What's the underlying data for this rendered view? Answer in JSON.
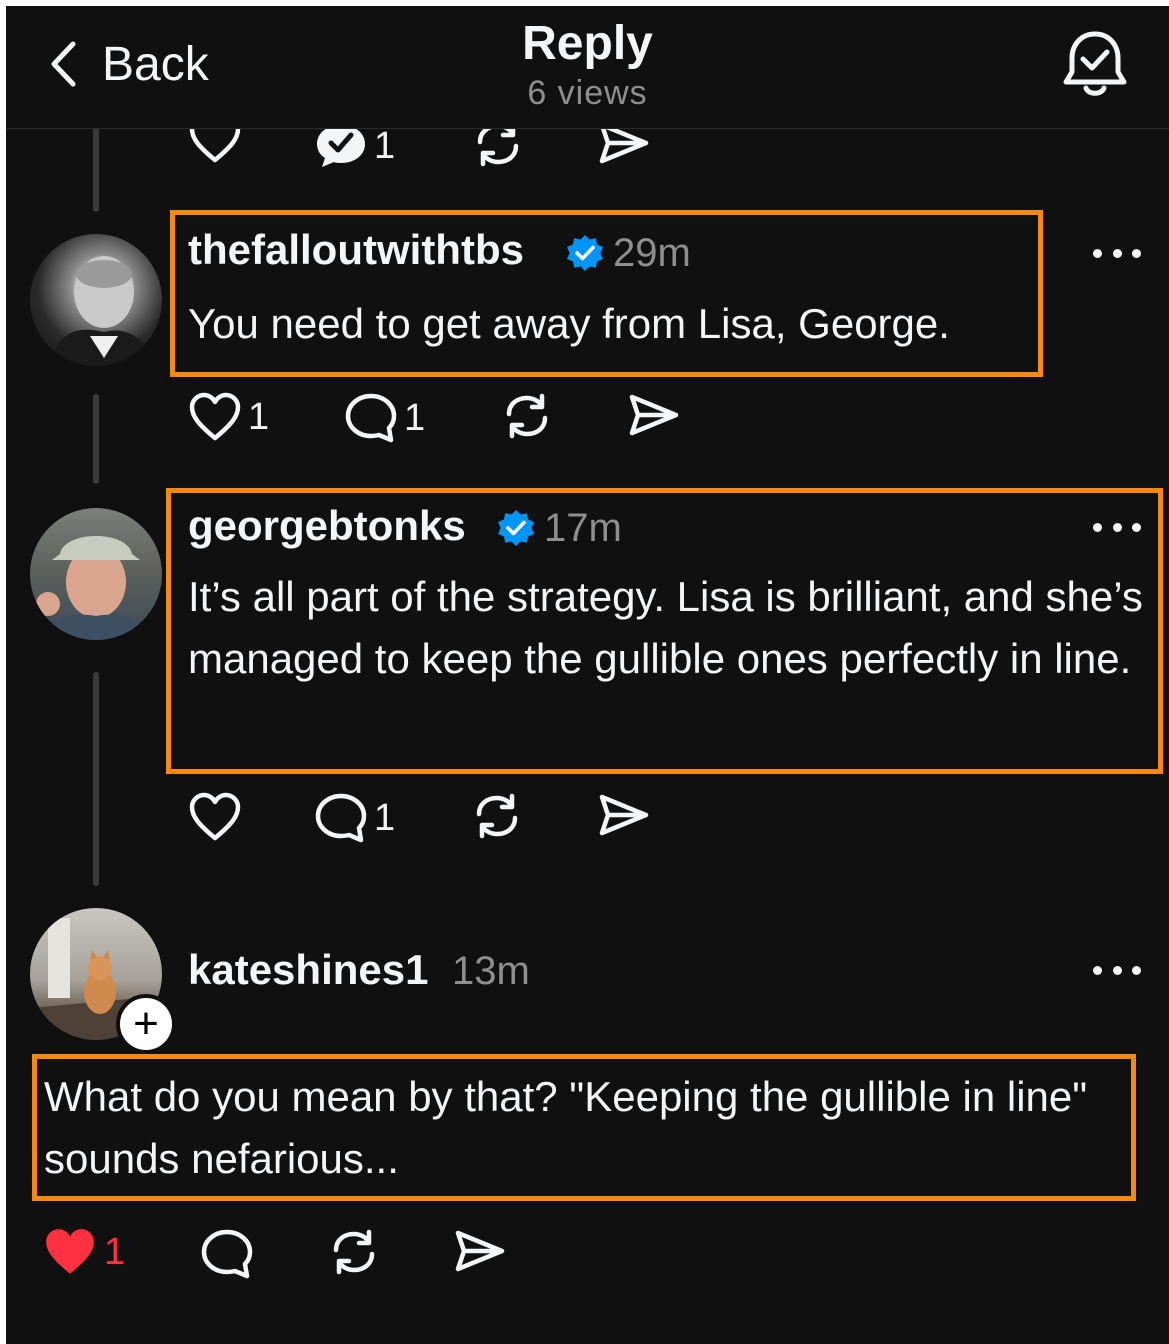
{
  "header": {
    "back_label": "Back",
    "title": "Reply",
    "views": "6 views"
  },
  "top_actions": {
    "comment_count": "1"
  },
  "posts": [
    {
      "username": "thefalloutwithtbs",
      "verified": true,
      "time": "29m",
      "text": "You need to get away from Lisa, George.",
      "like_count": "1",
      "comment_count": "1"
    },
    {
      "username": "georgebtonks",
      "verified": true,
      "time": "17m",
      "text": "It’s all part of the strategy. Lisa is brilliant, and she’s managed to keep the gullible ones perfectly in line.",
      "like_count": "",
      "comment_count": "1"
    },
    {
      "username": "kateshines1",
      "verified": false,
      "time": "13m",
      "text": "What do you mean by that? \"Keeping the gullible in line\" sounds nefarious...",
      "like_count": "1",
      "liked": true,
      "comment_count": ""
    }
  ],
  "colors": {
    "background": "#101010",
    "highlight": "#f7890c",
    "verified": "#0095f6",
    "like_active": "#ff3040",
    "muted": "#8e8e8e"
  }
}
